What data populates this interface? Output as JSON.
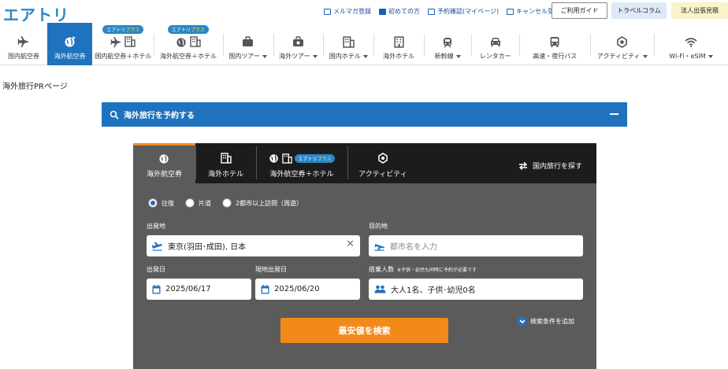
{
  "logo": "エアトリ",
  "header": {
    "links": [
      "メルマガ登録",
      "初めての方",
      "予約確認(マイページ)",
      "キャンセル受付"
    ],
    "guide_button": "ご利用ガイド",
    "column_button": "トラベルコラム",
    "corporate_button": "法人出張見積"
  },
  "nav": {
    "badge_main": "エアトリ",
    "badge_plus": "プラス",
    "items": [
      {
        "label": "国内航空券",
        "icon": "plane-icon"
      },
      {
        "label": "海外航空券",
        "icon": "globe-plane-icon"
      },
      {
        "label": "国内航空券＋ホテル",
        "icon": "plane-hotel-icon"
      },
      {
        "label": "海外航空券＋ホテル",
        "icon": "globe-hotel-icon"
      },
      {
        "label": "国内ツアー",
        "icon": "suitcase-icon"
      },
      {
        "label": "海外ツアー",
        "icon": "suitcase-icon"
      },
      {
        "label": "国内ホテル",
        "icon": "hotel-icon"
      },
      {
        "label": "海外ホテル",
        "icon": "hotel-icon"
      },
      {
        "label": "新幹線",
        "icon": "shinkansen-icon"
      },
      {
        "label": "レンタカー",
        "icon": "car-icon"
      },
      {
        "label": "高速・夜行バス",
        "icon": "bus-icon"
      },
      {
        "label": "アクティビティ",
        "icon": "activity-icon"
      },
      {
        "label": "Wi-Fi・eSIM",
        "icon": "wifi-icon"
      }
    ]
  },
  "page_title": "海外旅行PRページ",
  "search_bar": {
    "title": "海外旅行を予約する"
  },
  "panel": {
    "tabs": [
      "海外航空券",
      "海外ホテル",
      "海外航空券＋ホテル",
      "アクティビティ"
    ],
    "domestic_link": "国内旅行を探す",
    "trip_types": [
      "往復",
      "片道",
      "2都市以上訪問（周遊）"
    ],
    "selected_trip_type": "往復",
    "origin": {
      "label": "出発地",
      "value": "東京(羽田･成田), 日本"
    },
    "destination": {
      "label": "目的地",
      "placeholder": "都市名を入力"
    },
    "depart": {
      "label": "出発日",
      "value": "2025/06/17"
    },
    "return": {
      "label": "現地出発日",
      "value": "2025/06/20"
    },
    "passengers": {
      "label": "搭乗人数",
      "note": "※子供・幼児も同時に予約が必要です",
      "value": "大人1名、子供･幼児0名"
    },
    "search_button": "最安値を検索",
    "add_conditions": "検索条件を追加"
  },
  "colors": {
    "primary": "#1f72bd",
    "accent": "#f28a1b",
    "panel_bg": "#5b5b5b",
    "tabs_bg": "#1c1c1c"
  }
}
